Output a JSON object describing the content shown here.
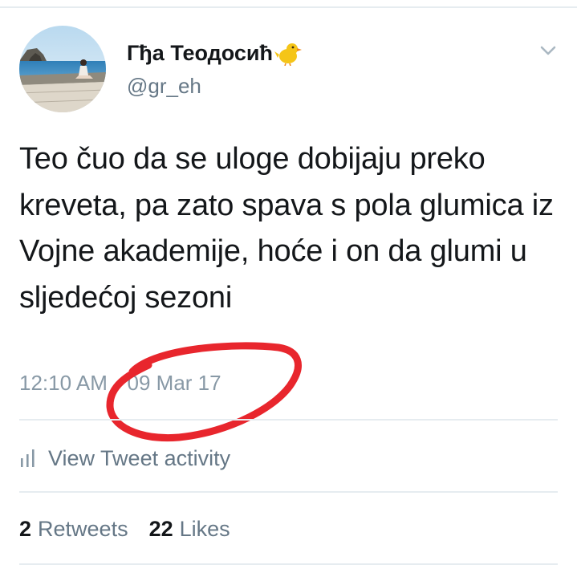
{
  "header": {
    "display_name": "Гђа Теодосић",
    "name_emoji": "chick-emoji",
    "username": "@gr_eh",
    "menu_icon": "chevron-down-icon"
  },
  "tweet": {
    "text": "Teo čuo da se uloge dobijaju preko kreveta, pa zato spava s pola glumica iz Vojne akademije, hoće i on da glumi u sljedećoj sezoni",
    "time": "12:10 AM",
    "separator": "·",
    "date": "09 Mar 17"
  },
  "activity": {
    "icon": "bar-chart-icon",
    "label": "View Tweet activity"
  },
  "stats": {
    "retweets_count": "2",
    "retweets_label": "Retweets",
    "likes_count": "22",
    "likes_label": "Likes"
  },
  "colors": {
    "text_primary": "#14171a",
    "text_secondary": "#657786",
    "text_meta": "#8899a6",
    "divider": "#e6ecf0",
    "annotation_red": "#e8262d"
  }
}
